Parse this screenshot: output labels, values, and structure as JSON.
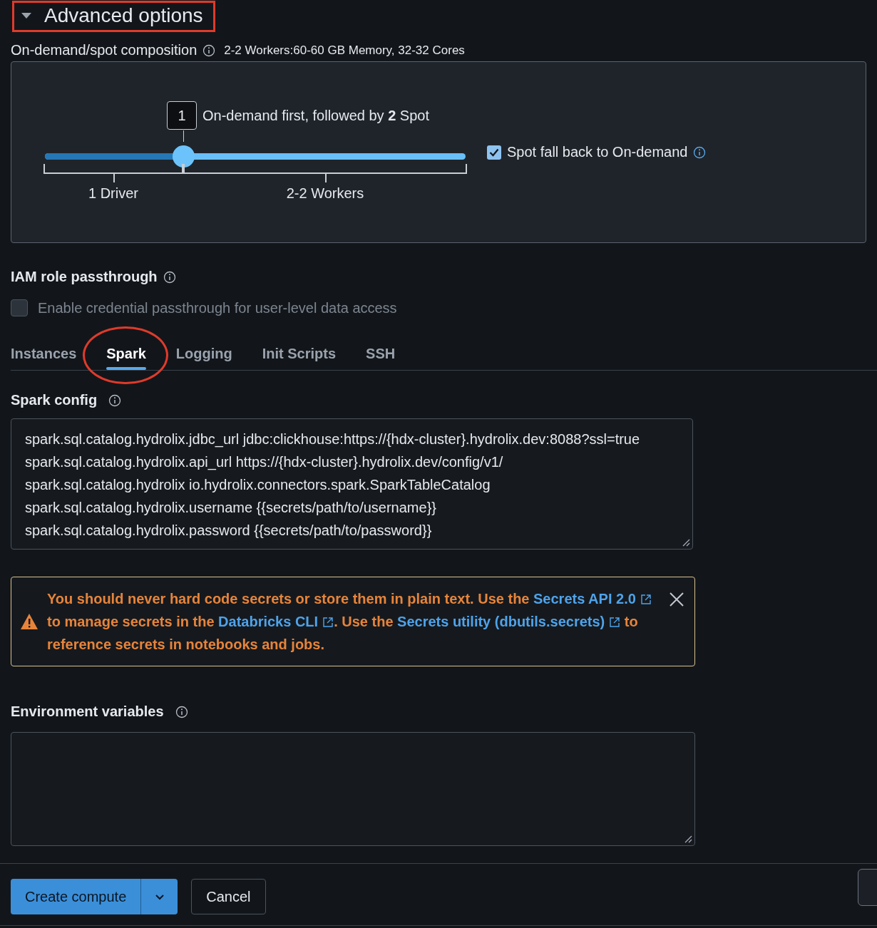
{
  "header": {
    "title": "Advanced options",
    "expanded": true,
    "framed": true
  },
  "composition": {
    "label": "On-demand/spot composition",
    "summary": "2-2 Workers:60-60 GB Memory, 32-32 Cores",
    "slider": {
      "value": "1",
      "caption": "On-demand first, followed by **2** Spot",
      "level": 0.33,
      "driver_label": "1 Driver",
      "workers_label": "2-2 Workers"
    },
    "fallback": {
      "label": "Spot fall back to On-demand",
      "checked": true
    }
  },
  "iam": {
    "label": "IAM role passthrough",
    "option": {
      "label": "Enable credential passthrough for user-level data access",
      "checked": false,
      "disabled": true
    }
  },
  "tabs": [
    {
      "label": "Instances",
      "selected": false,
      "circled": false
    },
    {
      "label": "Spark",
      "selected": true,
      "circled": true
    },
    {
      "label": "Logging",
      "selected": false,
      "circled": false
    },
    {
      "label": "Init Scripts",
      "selected": false,
      "circled": false
    },
    {
      "label": "SSH",
      "selected": false,
      "circled": false
    }
  ],
  "spark_config": {
    "label": "Spark config",
    "lines": [
      "spark.sql.catalog.hydrolix.jdbc_url jdbc:clickhouse:https://{hdx-cluster}.hydrolix.dev:8088?ssl=true",
      "spark.sql.catalog.hydrolix.api_url https://{hdx-cluster}.hydrolix.dev/config/v1/",
      "spark.sql.catalog.hydrolix io.hydrolix.connectors.spark.SparkTableCatalog",
      "spark.sql.catalog.hydrolix.username {{secrets/path/to/username}}",
      "spark.sql.catalog.hydrolix.password {{secrets/path/to/password}}"
    ]
  },
  "alert": {
    "segments": [
      {
        "kind": "text",
        "text": "You should never hard code secrets or store them in plain text. Use the "
      },
      {
        "kind": "link",
        "text": "Secrets API 2.0"
      },
      {
        "kind": "text",
        "text": " to manage secrets in the "
      },
      {
        "kind": "link",
        "text": "Databricks CLI"
      },
      {
        "kind": "text",
        "text": ". Use the "
      },
      {
        "kind": "link",
        "text": "Secrets utility (dbutils.secrets)"
      },
      {
        "kind": "text",
        "text": " to reference secrets in notebooks and jobs."
      }
    ]
  },
  "env_vars": {
    "label": "Environment variables"
  },
  "buttons": {
    "primary": "Create compute",
    "secondary": "Cancel"
  }
}
